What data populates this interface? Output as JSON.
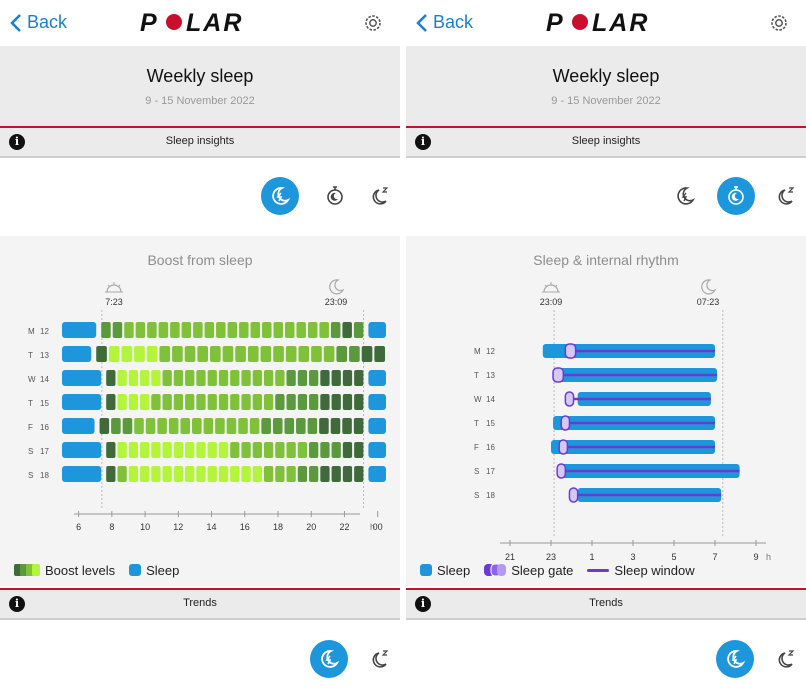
{
  "nav": {
    "back_label": "Back",
    "logo_text": "POLAR",
    "settings_icon": "gear-icon"
  },
  "colors": {
    "accent_blue": "#1e96dc",
    "polar_red": "#c8102e",
    "purple": "#6b3ad6",
    "boost_levels": [
      "#3f6a3a",
      "#5b9a3c",
      "#7fc23a",
      "#b2f53a"
    ]
  },
  "left": {
    "header": {
      "title": "Weekly sleep",
      "date_range": "9 - 15 November 2022"
    },
    "insights_label": "Sleep insights",
    "section_title": "Boost from sleep",
    "markers": {
      "wake_time": "7:23",
      "bed_time": "23:09"
    },
    "days": [
      {
        "letter": "M",
        "date": "12"
      },
      {
        "letter": "T",
        "date": "13"
      },
      {
        "letter": "W",
        "date": "14"
      },
      {
        "letter": "T",
        "date": "15"
      },
      {
        "letter": "F",
        "date": "16"
      },
      {
        "letter": "S",
        "date": "17"
      },
      {
        "letter": "S",
        "date": "18"
      }
    ],
    "x_ticks": [
      "6",
      "8",
      "10",
      "12",
      "14",
      "16",
      "18",
      "20",
      "22",
      "00"
    ],
    "x_unit": "h",
    "legend": {
      "boost_label": "Boost levels",
      "sleep_label": "Sleep"
    },
    "trends_label": "Trends",
    "chart_data": {
      "type": "heatmap",
      "x_range_hours": [
        5,
        24.5
      ],
      "sleep_until_hours": [
        7.3,
        7.0,
        7.6,
        7.6,
        7.2,
        7.6,
        7.6
      ],
      "sleep_from_hours": [
        23.2,
        24.5,
        23.2,
        23.2,
        23.2,
        23.2,
        23.2
      ],
      "boost_levels": [
        [
          1,
          1,
          2,
          2,
          2,
          2,
          2,
          2,
          2,
          2,
          2,
          2,
          2,
          2,
          2,
          2,
          2,
          2,
          2,
          2,
          1,
          0,
          1
        ],
        [
          0,
          3,
          3,
          3,
          3,
          2,
          2,
          2,
          2,
          2,
          2,
          2,
          2,
          2,
          2,
          2,
          2,
          2,
          2,
          1,
          1,
          0,
          0
        ],
        [
          0,
          3,
          3,
          3,
          3,
          2,
          2,
          2,
          2,
          2,
          2,
          2,
          2,
          2,
          2,
          2,
          1,
          1,
          1,
          0,
          0,
          0,
          0
        ],
        [
          0,
          3,
          3,
          3,
          2,
          2,
          2,
          2,
          2,
          2,
          2,
          2,
          2,
          2,
          2,
          1,
          1,
          1,
          1,
          0,
          0,
          0,
          0
        ],
        [
          0,
          1,
          1,
          2,
          2,
          2,
          2,
          2,
          2,
          2,
          2,
          2,
          2,
          2,
          1,
          1,
          1,
          1,
          1,
          0,
          0,
          0,
          0
        ],
        [
          0,
          3,
          3,
          3,
          3,
          3,
          3,
          3,
          3,
          3,
          3,
          2,
          2,
          2,
          2,
          2,
          2,
          2,
          1,
          1,
          1,
          0,
          0
        ],
        [
          0,
          2,
          3,
          3,
          3,
          3,
          3,
          3,
          3,
          3,
          3,
          3,
          3,
          3,
          2,
          2,
          2,
          1,
          1,
          0,
          0,
          0,
          0
        ]
      ]
    }
  },
  "right": {
    "header": {
      "title": "Weekly sleep",
      "date_range": "9 - 15 November 2022"
    },
    "insights_label": "Sleep insights",
    "section_title": "Sleep & internal rhythm",
    "markers": {
      "bed_time": "23:09",
      "wake_time": "07:23"
    },
    "days": [
      {
        "letter": "M",
        "date": "12"
      },
      {
        "letter": "T",
        "date": "13"
      },
      {
        "letter": "W",
        "date": "14"
      },
      {
        "letter": "T",
        "date": "15"
      },
      {
        "letter": "F",
        "date": "16"
      },
      {
        "letter": "S",
        "date": "17"
      },
      {
        "letter": "S",
        "date": "18"
      }
    ],
    "x_ticks": [
      "21",
      "23",
      "1",
      "3",
      "5",
      "7",
      "9"
    ],
    "x_unit": "h",
    "legend": {
      "sleep_label": "Sleep",
      "gate_label": "Sleep gate",
      "window_label": "Sleep window"
    },
    "trends_label": "Trends",
    "chart_data": {
      "type": "bar",
      "x_range_hours": [
        20,
        30
      ],
      "sleep_start": [
        22.6,
        23.1,
        24.3,
        23.1,
        23.0,
        23.3,
        24.3
      ],
      "sleep_end": [
        31.0,
        31.1,
        30.8,
        31.0,
        31.0,
        32.2,
        31.3
      ],
      "gate_start": [
        23.7,
        23.1,
        23.7,
        23.5,
        23.4,
        23.3,
        23.9
      ],
      "gate_end": [
        24.2,
        23.6,
        24.1,
        23.9,
        23.8,
        23.7,
        24.3
      ]
    }
  }
}
